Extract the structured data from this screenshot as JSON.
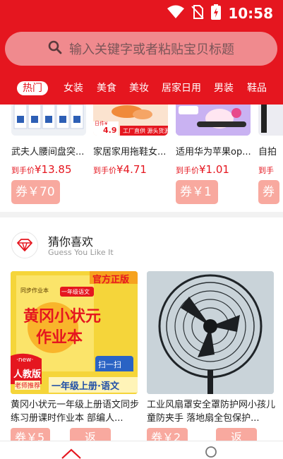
{
  "status_bar": {
    "time": "10:58"
  },
  "search": {
    "placeholder": "输入关键字或者粘贴宝贝标题"
  },
  "categories": [
    "热门",
    "女装",
    "美食",
    "美妆",
    "居家日用",
    "男装",
    "鞋品"
  ],
  "hot_items": [
    {
      "title": "武夫人腰间盘突...",
      "price_label": "到手价",
      "price": "¥13.85",
      "coupon": "券￥70"
    },
    {
      "title": "家居家用拖鞋女...",
      "price_label": "到手价",
      "price": "¥4.71",
      "coupon": ""
    },
    {
      "title": "适用华为苹果op...",
      "price_label": "到手价",
      "price": "¥1.01",
      "coupon": "券￥1"
    },
    {
      "title": "自拍",
      "price_label": "到手",
      "price": "",
      "coupon": "券"
    }
  ],
  "hot_thumb_text": {
    "item2_badge_price": "4.9",
    "item2_banner": "工厂直供 源头货源",
    "item2_top": "日件¥"
  },
  "guess": {
    "title": "猜你喜欢",
    "subtitle": "Guess You Like It"
  },
  "products": [
    {
      "title": "黄冈小状元一年级上册语文同步练习册课时作业本 部编人...",
      "coupon": "券￥5",
      "rebate": "返",
      "image_text": {
        "tag": "官方正版",
        "line1": "同步作业本",
        "line2": "一年级语文",
        "brand": "黄冈小状元",
        "book": "作业本",
        "scan": "扫一扫",
        "new": "·new·",
        "edition": "人教版",
        "teacher": "老师推荐",
        "grade": "一年级上册·语文"
      }
    },
    {
      "title": "工业风扇罩安全罩防护网小孩儿童防夹手 落地扇全包保护...",
      "coupon": "券￥2",
      "rebate": "返"
    }
  ],
  "colors": {
    "brand_red": "#e5161f",
    "coupon_pink": "#f8a99f",
    "search_bg": "#f08a8e"
  }
}
